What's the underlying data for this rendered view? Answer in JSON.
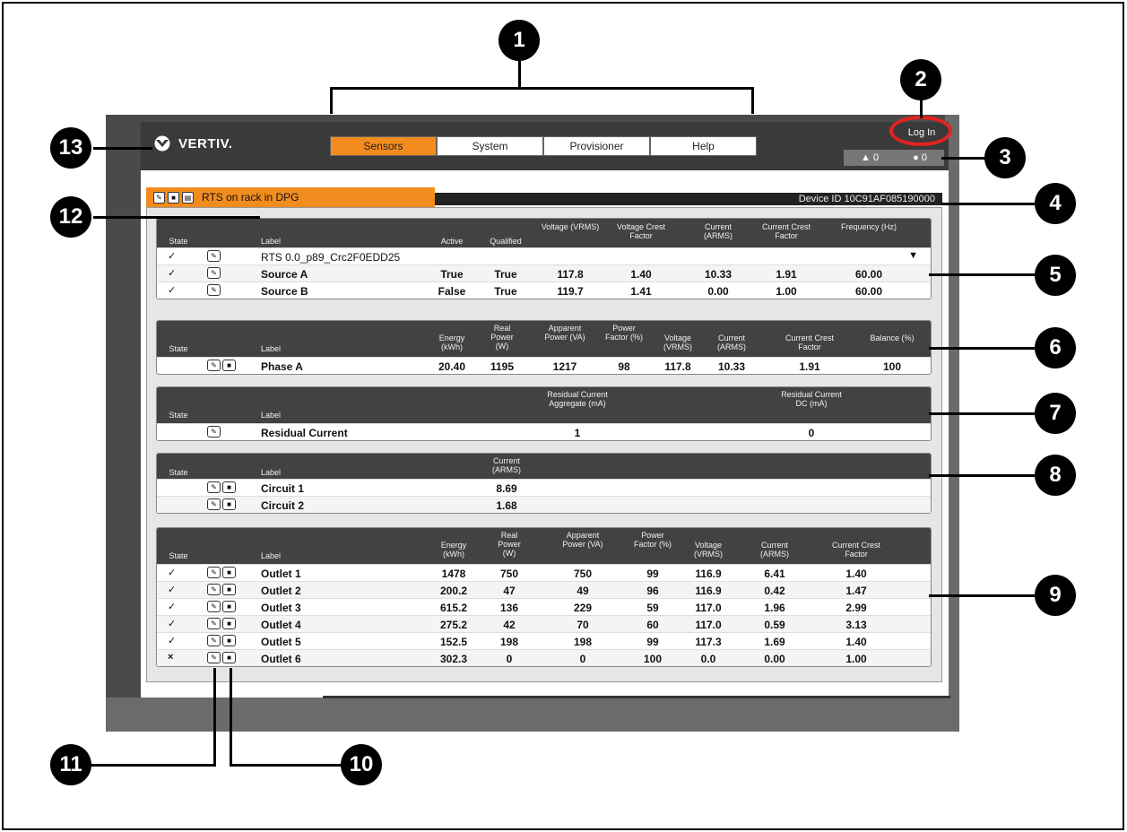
{
  "brand": {
    "name": "VERTIV."
  },
  "tabs": [
    {
      "label": "Sensors",
      "active": true
    },
    {
      "label": "System",
      "active": false
    },
    {
      "label": "Provisioner",
      "active": false
    },
    {
      "label": "Help",
      "active": false
    }
  ],
  "header": {
    "login_label": "Log In",
    "alarm_count": "0",
    "info_count": "0"
  },
  "device": {
    "title": "RTS on rack in DPG",
    "id_label": "Device ID 10C91AF085190000"
  },
  "rts_table": {
    "headers": [
      "State",
      "Label",
      "Active",
      "Qualified",
      "Voltage (VRMS)",
      "Voltage Crest Factor",
      "Current (ARMS)",
      "Current Crest Factor",
      "Frequency (Hz)"
    ],
    "group_row": {
      "state": "✓",
      "label": "RTS 0.0_p89_Crc2F0EDD25"
    },
    "rows": [
      {
        "state": "✓",
        "label": "Source A",
        "active": "True",
        "qualified": "True",
        "voltage": "117.8",
        "vcf": "1.40",
        "current": "10.33",
        "ccf": "1.91",
        "freq": "60.00"
      },
      {
        "state": "✓",
        "label": "Source B",
        "active": "False",
        "qualified": "True",
        "voltage": "119.7",
        "vcf": "1.41",
        "current": "0.00",
        "ccf": "1.00",
        "freq": "60.00"
      }
    ]
  },
  "phase_table": {
    "headers": [
      "State",
      "Label",
      "Energy (kWh)",
      "Real Power (W)",
      "Apparent Power (VA)",
      "Power Factor (%)",
      "Voltage (VRMS)",
      "Current (ARMS)",
      "Current Crest Factor",
      "Balance (%)"
    ],
    "rows": [
      {
        "label": "Phase A",
        "energy": "20.40",
        "real": "1195",
        "apparent": "1217",
        "pf": "98",
        "voltage": "117.8",
        "current": "10.33",
        "ccf": "1.91",
        "balance": "100"
      }
    ]
  },
  "residual_table": {
    "headers": [
      "State",
      "Label",
      "Residual Current Aggregate (mA)",
      "Residual Current DC (mA)"
    ],
    "rows": [
      {
        "label": "Residual Current",
        "aggregate": "1",
        "dc": "0"
      }
    ]
  },
  "circuit_table": {
    "headers": [
      "State",
      "Label",
      "Current (ARMS)"
    ],
    "rows": [
      {
        "label": "Circuit 1",
        "current": "8.69"
      },
      {
        "label": "Circuit 2",
        "current": "1.68"
      }
    ]
  },
  "outlet_table": {
    "headers": [
      "State",
      "Label",
      "Energy (kWh)",
      "Real Power (W)",
      "Apparent Power (VA)",
      "Power Factor (%)",
      "Voltage (VRMS)",
      "Current (ARMS)",
      "Current Crest Factor"
    ],
    "rows": [
      {
        "state": "✓",
        "label": "Outlet 1",
        "energy": "1478",
        "real": "750",
        "apparent": "750",
        "pf": "99",
        "voltage": "116.9",
        "current": "6.41",
        "ccf": "1.40"
      },
      {
        "state": "✓",
        "label": "Outlet 2",
        "energy": "200.2",
        "real": "47",
        "apparent": "49",
        "pf": "96",
        "voltage": "116.9",
        "current": "0.42",
        "ccf": "1.47"
      },
      {
        "state": "✓",
        "label": "Outlet 3",
        "energy": "615.2",
        "real": "136",
        "apparent": "229",
        "pf": "59",
        "voltage": "117.0",
        "current": "1.96",
        "ccf": "2.99"
      },
      {
        "state": "✓",
        "label": "Outlet 4",
        "energy": "275.2",
        "real": "42",
        "apparent": "70",
        "pf": "60",
        "voltage": "117.0",
        "current": "0.59",
        "ccf": "3.13"
      },
      {
        "state": "✓",
        "label": "Outlet 5",
        "energy": "152.5",
        "real": "198",
        "apparent": "198",
        "pf": "99",
        "voltage": "117.3",
        "current": "1.69",
        "ccf": "1.40"
      },
      {
        "state": "×",
        "label": "Outlet 6",
        "energy": "302.3",
        "real": "0",
        "apparent": "0",
        "pf": "100",
        "voltage": "0.0",
        "current": "0.00",
        "ccf": "1.00"
      }
    ]
  },
  "callouts": [
    "1",
    "2",
    "3",
    "4",
    "5",
    "6",
    "7",
    "8",
    "9",
    "10",
    "11",
    "12",
    "13"
  ],
  "colors": {
    "accent": "#f28c1e",
    "header": "#424242",
    "callout_ring": "#e52222"
  }
}
